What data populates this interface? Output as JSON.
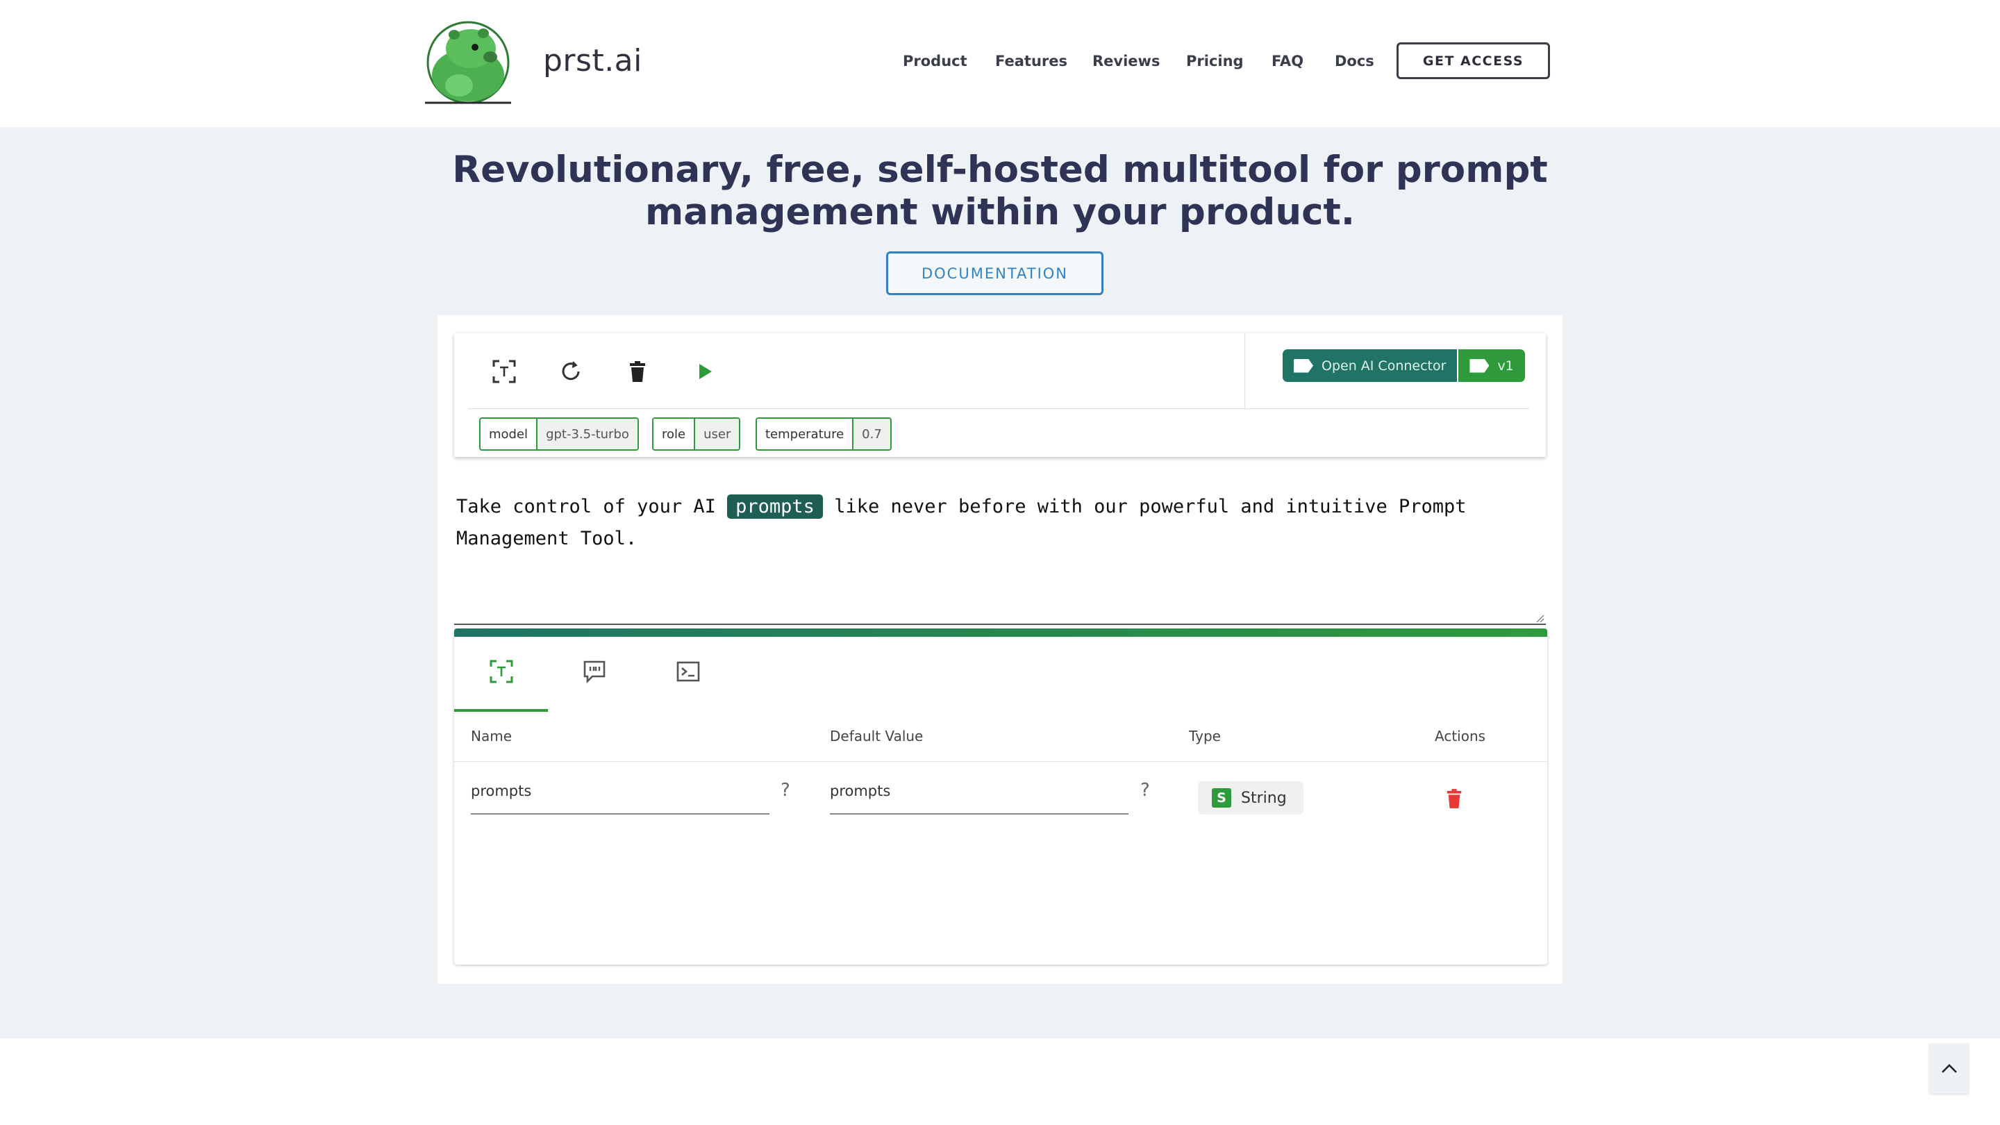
{
  "header": {
    "brand": "prst.ai",
    "nav": [
      "Product",
      "Features",
      "Reviews",
      "Pricing",
      "FAQ",
      "Docs"
    ],
    "cta": "GET ACCESS"
  },
  "hero": {
    "headline_line1": "Revolutionary, free, self-hosted multitool for prompt",
    "headline_line2": "management within your product.",
    "docs_button": "DOCUMENTATION"
  },
  "toolbar": {
    "icons": [
      "variable-icon",
      "refresh-icon",
      "trash-icon",
      "play-icon"
    ],
    "params": [
      {
        "key": "model",
        "value": "gpt-3.5-turbo"
      },
      {
        "key": "role",
        "value": "user"
      },
      {
        "key": "temperature",
        "value": "0.7"
      }
    ],
    "connector_tag": "Open AI Connector",
    "version_tag": "v1"
  },
  "editor": {
    "text_before": "Take control of your AI",
    "variable": "prompts",
    "text_after": "like never before with our powerful and intuitive Prompt",
    "text_line2": "Management Tool."
  },
  "variables": {
    "columns": [
      "Name",
      "Default Value",
      "Type",
      "Actions"
    ],
    "rows": [
      {
        "name": "prompts",
        "default_value": "prompts",
        "type": "String",
        "type_badge": "S"
      }
    ],
    "help_mark": "?"
  },
  "colors": {
    "accent_green": "#2e9a3c",
    "accent_teal": "#1f7466",
    "heading": "#2f3456",
    "docs_blue": "#2f82c4",
    "delete_red": "#e53935"
  }
}
